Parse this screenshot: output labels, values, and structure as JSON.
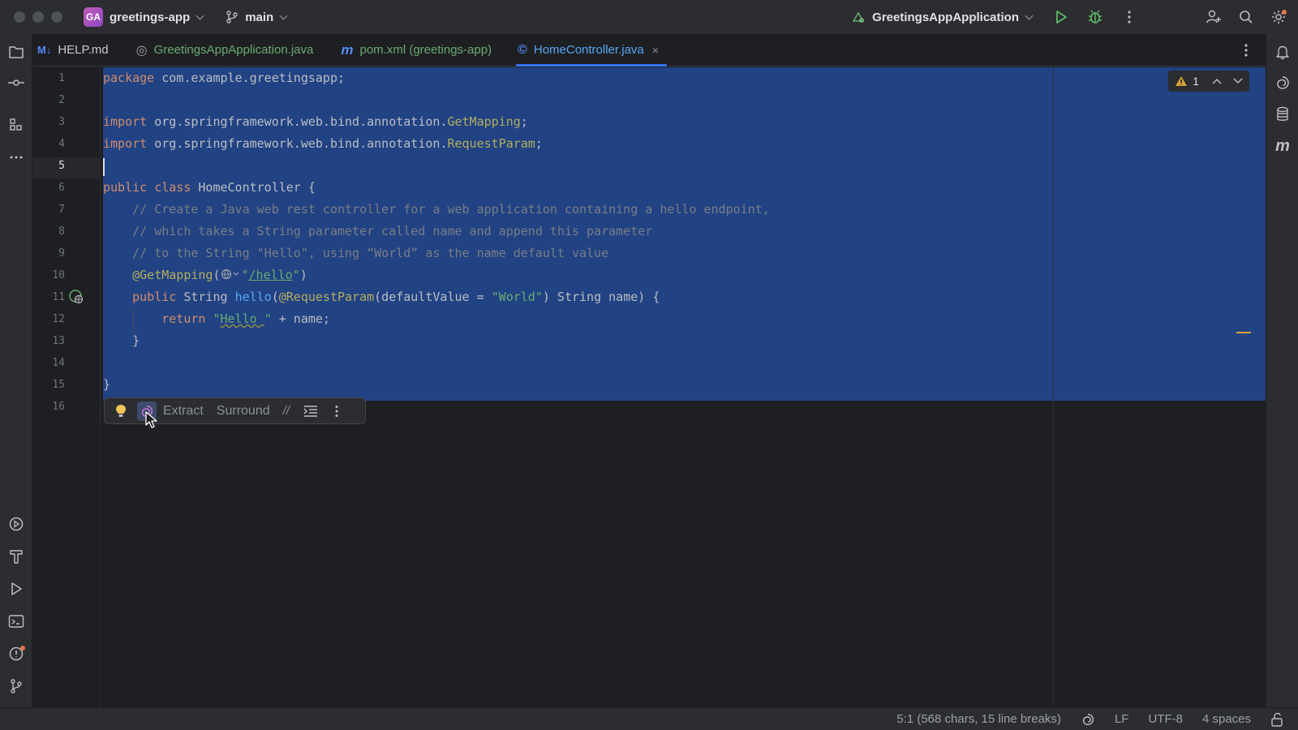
{
  "titlebar": {
    "project_initials": "GA",
    "project_name": "greetings-app",
    "branch": "main",
    "run_config": "GreetingsAppApplication"
  },
  "tabs": [
    {
      "icon": "M↓",
      "label": "HELP.md",
      "icon_color": "#548af7"
    },
    {
      "icon": "◎",
      "label": "GreetingsAppApplication.java",
      "icon_color": "#6aab73"
    },
    {
      "icon": "m",
      "label": "pom.xml (greetings-app)",
      "icon_color": "#6aab73"
    },
    {
      "icon": "©",
      "label": "HomeController.java",
      "icon_color": "#548af7",
      "active": true
    }
  ],
  "tab_close": "×",
  "editor": {
    "line_numbers": [
      "1",
      "2",
      "3",
      "4",
      "5",
      "6",
      "7",
      "8",
      "9",
      "10",
      "11",
      "12",
      "13",
      "14",
      "15",
      "16"
    ],
    "current_line": "5",
    "warning_count": "1",
    "code": {
      "l1_kw": "package",
      "l1_rest": " com.example.greetingsapp;",
      "l3_kw": "import",
      "l3_mid": " org.springframework.web.bind.annotation.",
      "l3_an": "GetMapping",
      "l3_end": ";",
      "l4_kw": "import",
      "l4_mid": " org.springframework.web.bind.annotation.",
      "l4_an": "RequestParam",
      "l4_end": ";",
      "l6_kw": "public class",
      "l6_rest": " HomeController {",
      "l7": "    // Create a Java web rest controller for a web application containing a hello endpoint,",
      "l8": "    // which takes a String parameter called name and append this parameter",
      "l9": "    // to the String \"Hello\", using “World” as the name default value",
      "l10_an": "    @GetMapping",
      "l10_open": "(",
      "l10_str_open": "\"",
      "l10_url": "/hello",
      "l10_str_close": "\"",
      "l10_close": ")",
      "l11_kw": "    public",
      "l11_type": " String ",
      "l11_fn": "hello",
      "l11_open": "(",
      "l11_an": "@RequestParam",
      "l11_mid": "(defaultValue = ",
      "l11_str": "\"World\"",
      "l11_end": ") String name) {",
      "l12_kw": "        return",
      "l12_sp": " ",
      "l12_str_q1": "\"",
      "l12_str": "Hello ",
      "l12_str_q2": "\"",
      "l12_rest": " + name;",
      "l13": "    }",
      "l15": "}"
    }
  },
  "floating_toolbar": {
    "extract": "Extract",
    "surround": "Surround",
    "comment": "//"
  },
  "statusbar": {
    "position": "5:1 (568 chars, 15 line breaks)",
    "line_ending": "LF",
    "encoding": "UTF-8",
    "indent": "4 spaces"
  }
}
